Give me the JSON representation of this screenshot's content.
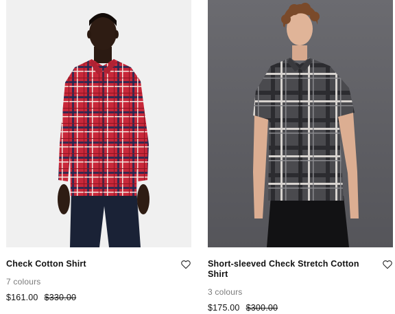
{
  "products": [
    {
      "title": "Check Cotton Shirt",
      "colours": "7 colours",
      "price_now": "$161.00",
      "price_was": "$330.00",
      "wishlist_icon": "heart-outline-icon",
      "image": "model in red tartan check long-sleeve shirt"
    },
    {
      "title": "Short-sleeved Check Stretch Cotton Shirt",
      "colours": "3 colours",
      "price_now": "$175.00",
      "price_was": "$300.00",
      "wishlist_icon": "heart-outline-icon",
      "image": "model in charcoal check short-sleeve shirt"
    }
  ],
  "colors": {
    "red_check": "#c8283a",
    "charcoal_check": "#4a4a4e",
    "studio_light": "#f0f0f0",
    "studio_dark": "#5f5f64"
  }
}
